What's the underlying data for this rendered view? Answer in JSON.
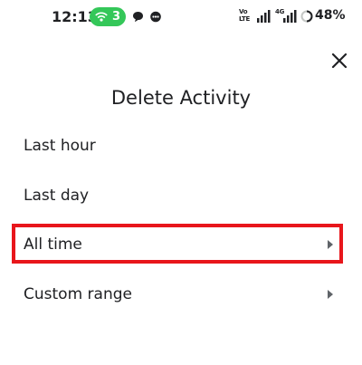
{
  "status_bar": {
    "time": "12:13",
    "hotspot_count": "3",
    "volte_top": "Vo",
    "volte_mid": "LTE",
    "network_type": "4G",
    "battery_percent": "48%"
  },
  "dialog": {
    "title": "Delete Activity",
    "items": [
      {
        "label": "Last hour",
        "has_chevron": false
      },
      {
        "label": "Last day",
        "has_chevron": false
      },
      {
        "label": "All time",
        "has_chevron": true,
        "highlighted": true
      },
      {
        "label": "Custom range",
        "has_chevron": true
      }
    ]
  },
  "colors": {
    "highlight_border": "#e8161b",
    "hotspot_pill": "#34c759",
    "text_primary": "#202124",
    "chevron": "#5f6368"
  }
}
